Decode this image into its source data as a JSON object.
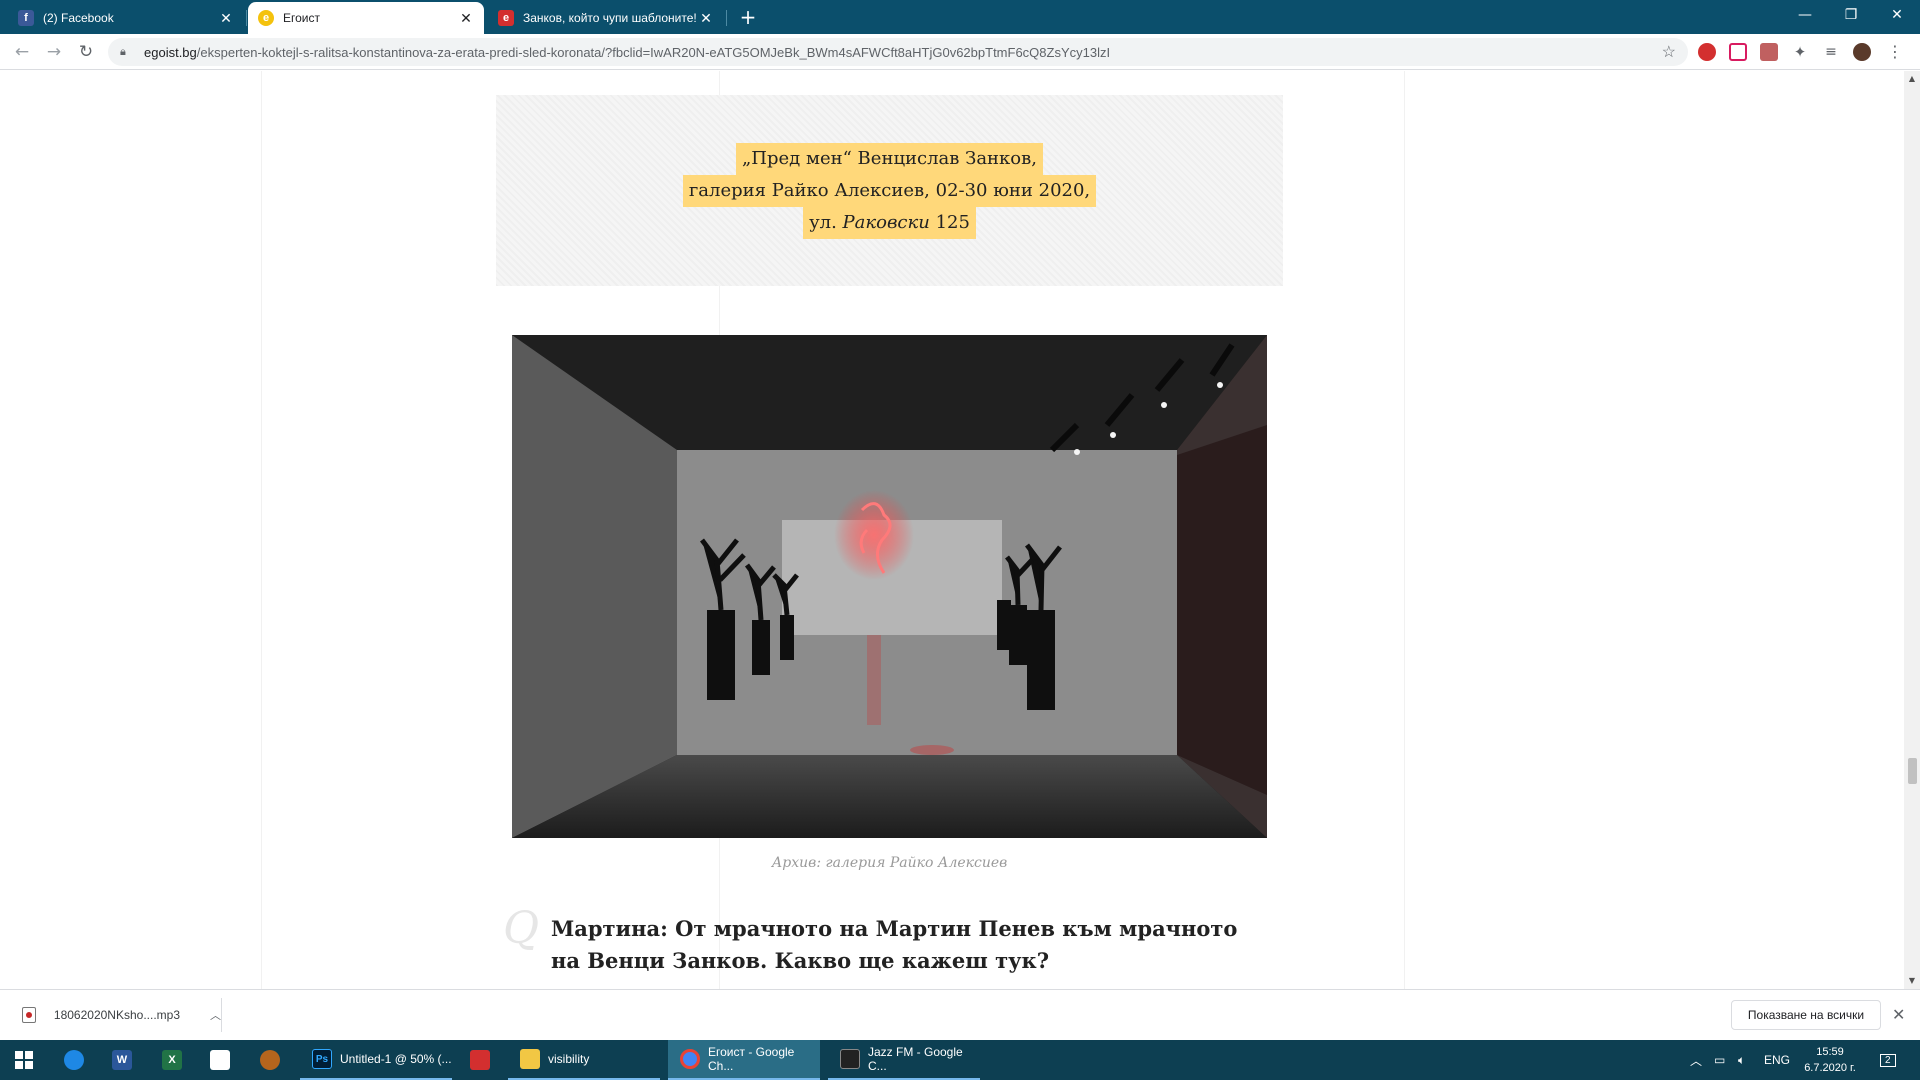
{
  "browser": {
    "tabs": [
      {
        "title": "(2) Facebook",
        "favicon": "facebook-icon",
        "color": "#3b5998"
      },
      {
        "title": "Егоист",
        "favicon": "egoist-icon",
        "color": "#f4c20d"
      },
      {
        "title": "Занков, който чупи шаблоните!",
        "favicon": "egoist-red-icon",
        "color": "#d32f2f"
      }
    ],
    "new_tab_symbol": "+",
    "url_host": "egoist.bg",
    "url_path": "/eksperten-koktejl-s-ralitsa-konstantinova-za-erata-predi-sled-koronata/?fbclid=IwAR20N-eATG5OMJeBk_BWm4sAFWCft8aHTjG0v62bpTtmF6cQ8ZsYcy13lzI"
  },
  "article": {
    "quote_line1": "„Пред мен“ Венцислав Занков,",
    "quote_line2": "галерия Райко Алексиев, 02-30 юни 2020,",
    "quote_line3_prefix": "ул. ",
    "quote_line3_street": "Раковски",
    "quote_line3_number": " 125",
    "photo_caption": "Архив: галерия Райко Алексиев",
    "question_mark": "Q",
    "question": "Мартина: От мрачното на Мартин Пенев към мрачното на Венци Занков. Какво ще кажеш тук?"
  },
  "downloads": {
    "file_name": "18062020NKsho....mp3",
    "show_all_label": "Показване на всички"
  },
  "taskbar": {
    "apps": [
      {
        "label": "Untitled-1 @ 50% (...",
        "icon": "photoshop-icon",
        "color": "#001e36",
        "glyph": "Ps"
      },
      {
        "label": "visibility",
        "icon": "folder-icon",
        "color": "#f2c744",
        "glyph": ""
      },
      {
        "label": "Егоист - Google Ch...",
        "icon": "chrome-icon",
        "color": "#4285f4",
        "glyph": "",
        "active": true
      },
      {
        "label": "Jazz FM - Google C...",
        "icon": "jazzfm-icon",
        "color": "#222222",
        "glyph": ""
      }
    ],
    "lang": "ENG",
    "time": "15:59",
    "date": "6.7.2020 г.",
    "notifications": "2"
  }
}
